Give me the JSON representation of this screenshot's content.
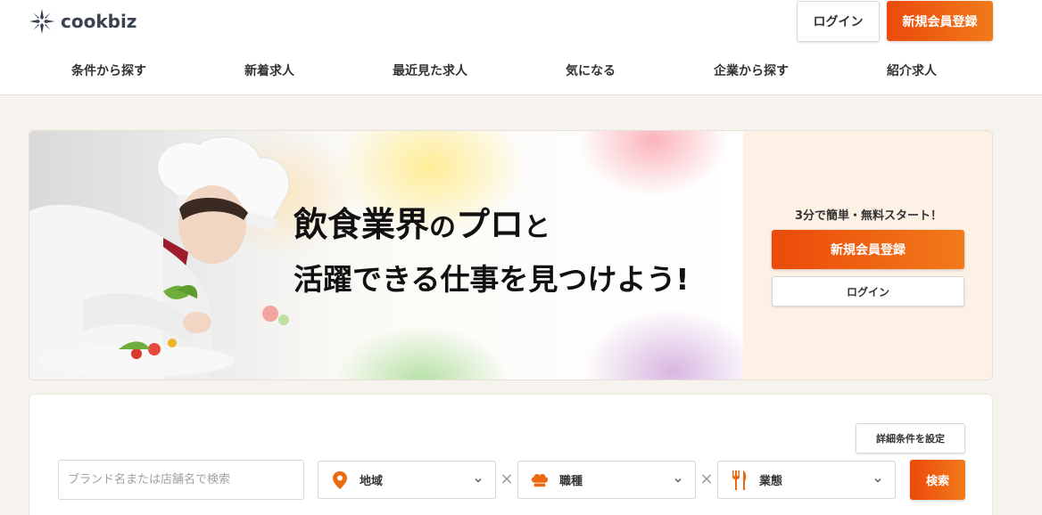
{
  "header": {
    "logo_text": "cookbiz",
    "login_label": "ログイン",
    "signup_label": "新規会員登録"
  },
  "nav": {
    "items": [
      {
        "label": "条件から探す"
      },
      {
        "label": "新着求人"
      },
      {
        "label": "最近見た求人"
      },
      {
        "label": "気になる"
      },
      {
        "label": "企業から探す"
      },
      {
        "label": "紹介求人"
      }
    ]
  },
  "hero": {
    "headline_part1": "飲食業界",
    "headline_part2": "の",
    "headline_part3": "プロ",
    "headline_part4": "と",
    "headline_line2": "活躍できる仕事を見つけよう!",
    "side_caption": "3分で簡単・無料スタート！",
    "signup_label": "新規会員登録",
    "login_label": "ログイン"
  },
  "search": {
    "detail_label": "詳細条件を設定",
    "keyword_placeholder": "ブランド名または店舗名で検索",
    "region_label": "地域",
    "job_label": "職種",
    "industry_label": "業態",
    "separator": "×",
    "submit_label": "検索"
  },
  "colors": {
    "accent": "#ec4a0a",
    "accent_light": "#f17a1a",
    "hero_side_bg": "#fdf0e4",
    "page_bg": "#f6f2ee",
    "logo": "#3a4250"
  },
  "icons": {
    "logo": "cookbiz-star-logo-icon",
    "region": "map-pin-icon",
    "job": "chef-hat-icon",
    "industry": "fork-knife-icon",
    "dropdown": "chevron-down-icon"
  }
}
